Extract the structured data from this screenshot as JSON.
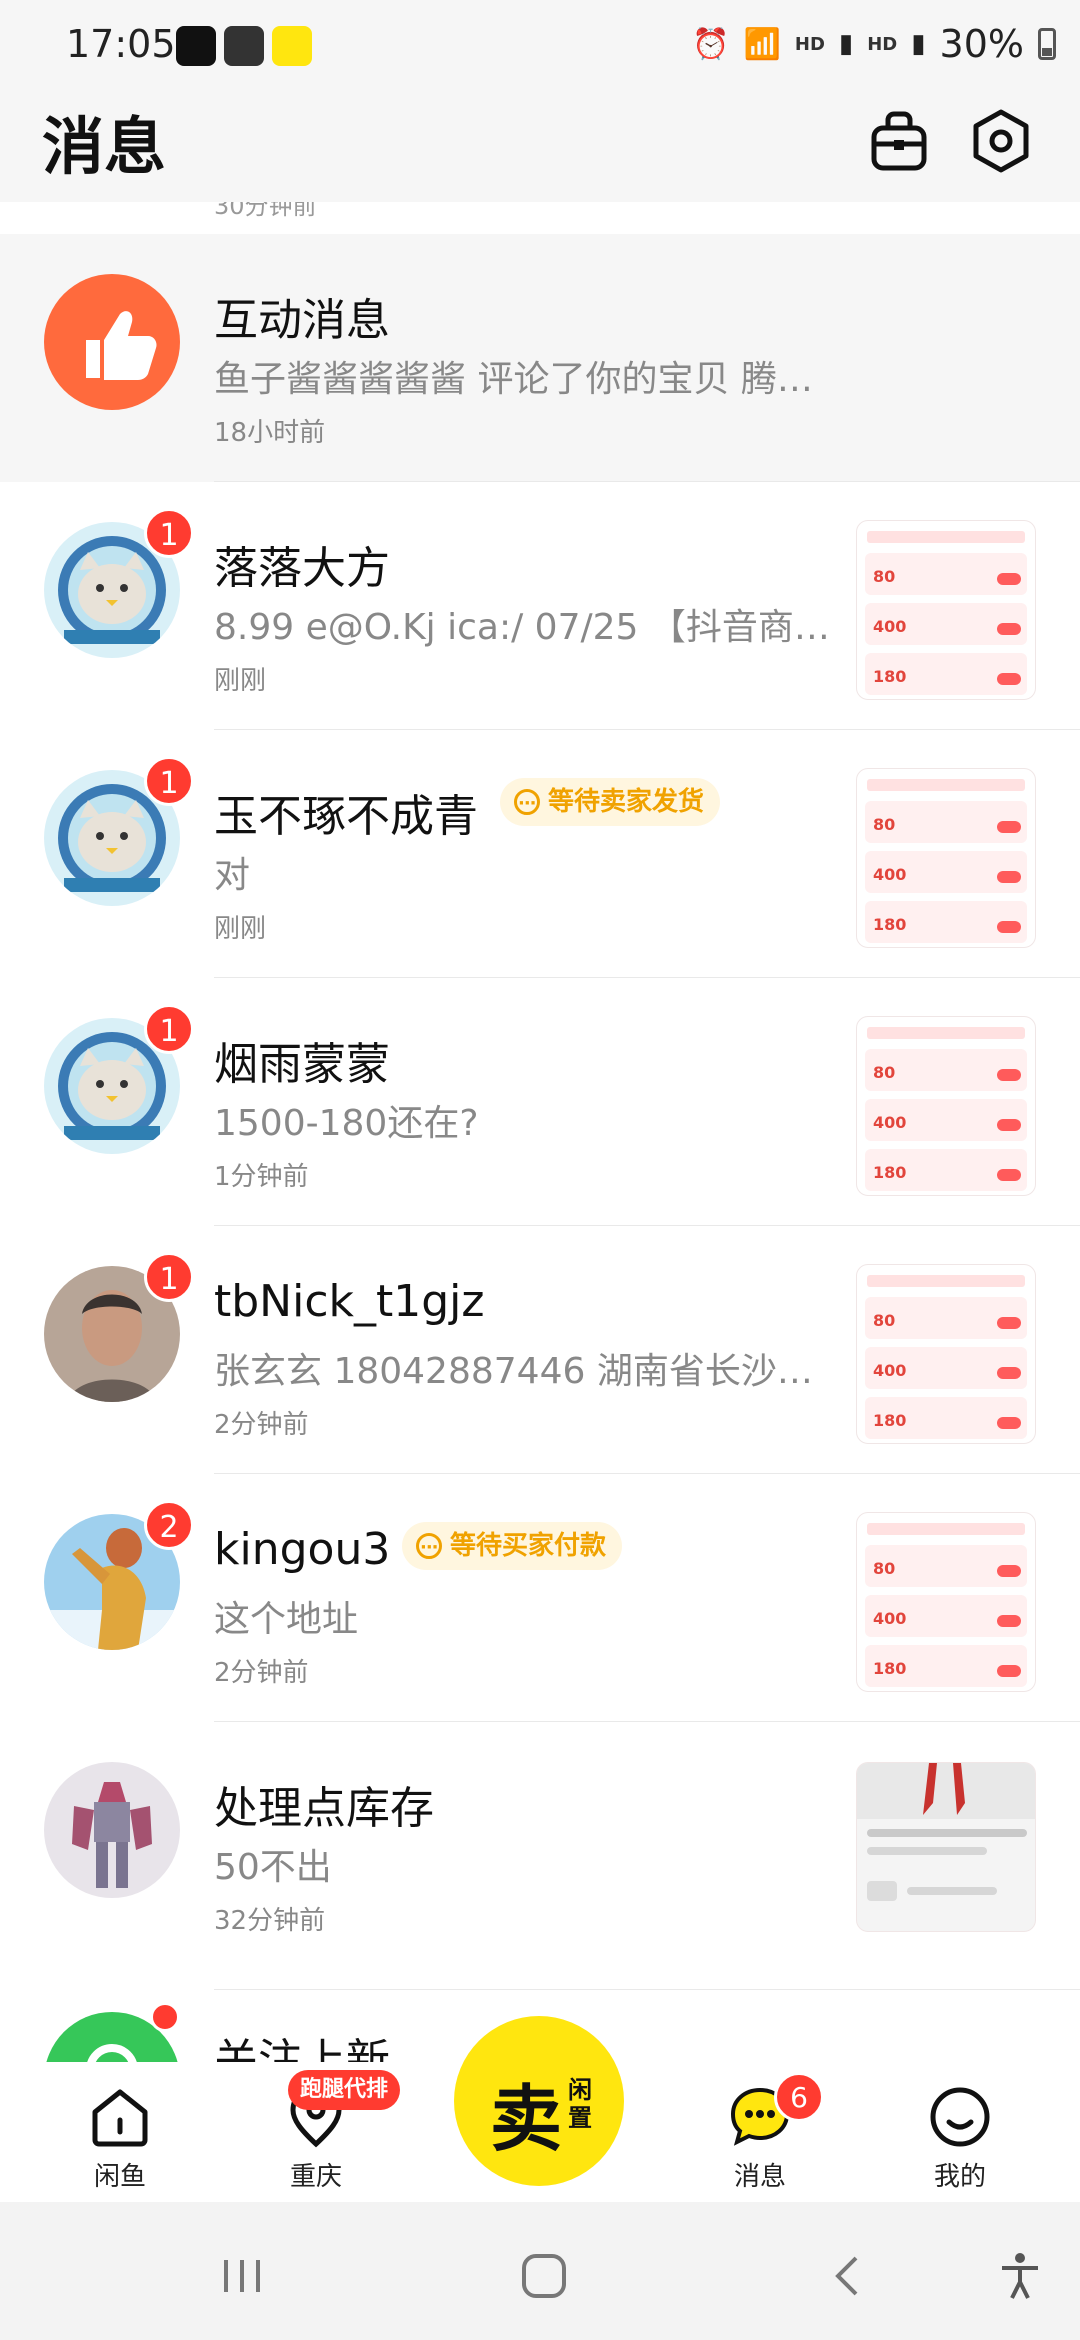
{
  "status_bar": {
    "time": "17:05",
    "network_label_1": "HD",
    "network_label_2": "HD",
    "battery": "30%"
  },
  "header": {
    "title": "消息",
    "icons": [
      "bag-icon",
      "settings-icon"
    ]
  },
  "list": {
    "peek_text": "30分钟前",
    "conversations": [
      {
        "name": "互动消息",
        "preview": "鱼子酱酱酱酱酱 评论了你的宝贝 腾…",
        "time": "18小时前",
        "badge": "",
        "avatar": "thumbs-up-icon",
        "accent": "#ff6a3d"
      },
      {
        "name": "落落大方",
        "preview": "8.99 e@O.Kj ica:/ 07/25 【抖音商…",
        "time": "刚刚",
        "badge": "1",
        "avatar": "cat-astronaut-avatar"
      },
      {
        "name": "玉不琢不成青",
        "status": "等待卖家发货",
        "preview": "对",
        "time": "刚刚",
        "badge": "1",
        "avatar": "cat-astronaut-avatar"
      },
      {
        "name": "烟雨蒙蒙",
        "preview": "1500-180还在?",
        "time": "1分钟前",
        "badge": "1",
        "avatar": "cat-astronaut-avatar"
      },
      {
        "name": "tbNick_t1gjz",
        "preview": "张玄玄 18042887446 湖南省长沙…",
        "time": "2分钟前",
        "badge": "1",
        "avatar": "person-photo-avatar"
      },
      {
        "name": "kingou3",
        "status": "等待买家付款",
        "preview": "这个地址",
        "time": "2分钟前",
        "badge": "2",
        "avatar": "golden-figure-avatar"
      },
      {
        "name": "处理点库存",
        "preview": "50不出",
        "time": "32分钟前",
        "badge": "",
        "avatar": "robot-model-avatar"
      },
      {
        "name": "关注上新",
        "preview": "",
        "time": "",
        "badge": "",
        "avatar": "follow-new-icon",
        "accent": "#36c759"
      }
    ],
    "thumbnail_prices": [
      "80",
      "400",
      "180"
    ]
  },
  "bottom_nav": {
    "items": [
      {
        "label": "闲鱼",
        "icon": "home-icon"
      },
      {
        "label": "重庆",
        "icon": "location-icon",
        "tag": "跑腿代排"
      },
      {
        "label": "",
        "icon": "sell-button"
      },
      {
        "label": "消息",
        "icon": "message-icon",
        "count": "6"
      },
      {
        "label": "我的",
        "icon": "profile-icon"
      }
    ],
    "sell_main": "卖",
    "sell_sub": "闲置"
  },
  "system_nav": [
    "recents-icon",
    "home-circle-icon",
    "back-icon",
    "accessibility-icon"
  ],
  "colors": {
    "badge": "#ff3b30",
    "brand_yellow": "#ffe60f",
    "status_tag_text": "#f0a200",
    "status_tag_bg": "#fff6df"
  }
}
